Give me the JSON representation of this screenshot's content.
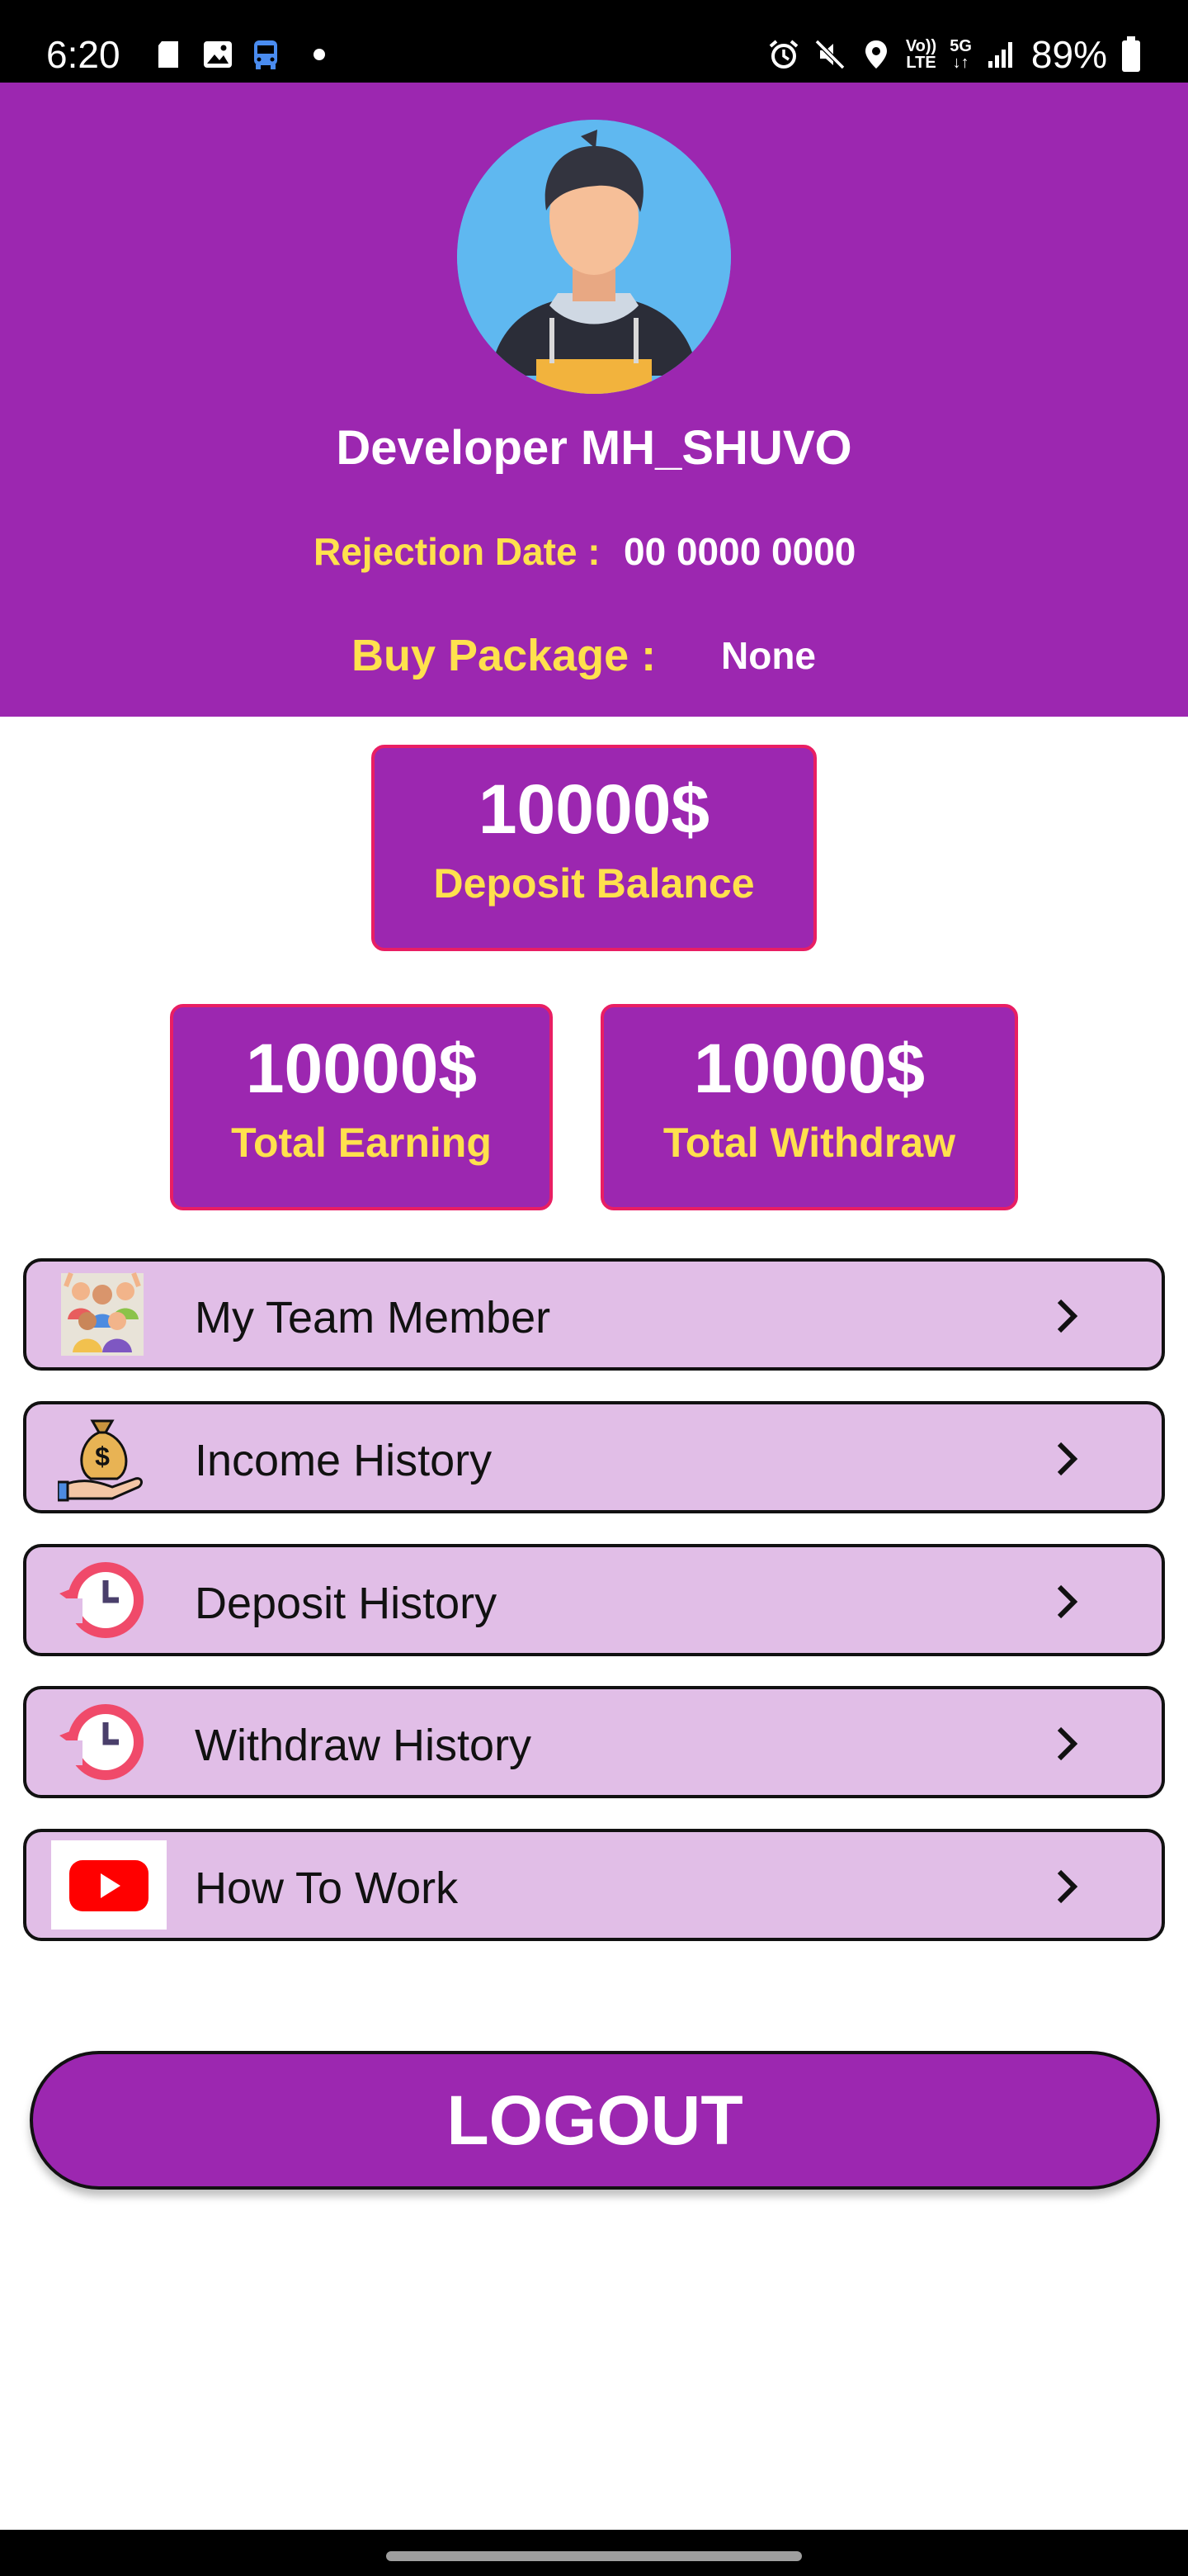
{
  "status_bar": {
    "time": "6:20",
    "battery": "89%",
    "network_top": "Vo))",
    "network_bottom": "LTE",
    "network_5g": "5G"
  },
  "profile": {
    "name": "Developer MH_SHUVO",
    "rejection_label": "Rejection Date :",
    "rejection_value": "00 0000 0000",
    "package_label": "Buy Package :",
    "package_value": "None"
  },
  "stats": {
    "deposit": {
      "value": "10000$",
      "label": "Deposit Balance"
    },
    "earning": {
      "value": "10000$",
      "label": "Total Earning"
    },
    "withdraw": {
      "value": "10000$",
      "label": "Total Withdraw"
    }
  },
  "menu": [
    {
      "label": "My Team Member",
      "icon": "team-icon"
    },
    {
      "label": "Income History",
      "icon": "money-bag-icon"
    },
    {
      "label": "Deposit History",
      "icon": "history-clock-icon"
    },
    {
      "label": "Withdraw History",
      "icon": "history-clock-icon"
    },
    {
      "label": "How To Work",
      "icon": "youtube-icon"
    }
  ],
  "logout_label": "LOGOUT",
  "colors": {
    "primary": "#9c27b0",
    "accent_text": "#ffe14d",
    "card_border": "#e91e63",
    "menu_bg": "#e1bee7"
  }
}
